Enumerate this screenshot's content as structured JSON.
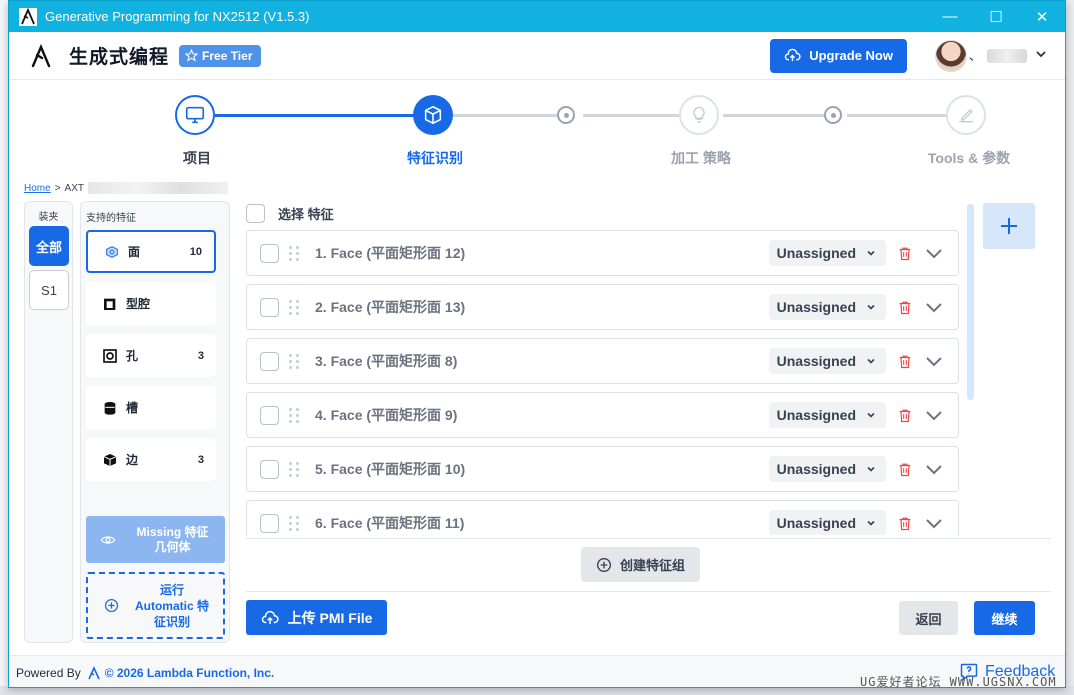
{
  "window": {
    "title": "Generative Programming for NX2512 (V1.5.3)",
    "minimize": "—",
    "maximize": "☐",
    "close": "✕"
  },
  "header": {
    "brand": "生成式编程",
    "tier": "Free Tier",
    "upgrade": "Upgrade Now",
    "user_sep": "、"
  },
  "steps": [
    {
      "label": "项目",
      "state": "done"
    },
    {
      "label": "特征识别",
      "state": "active"
    },
    {
      "label": "加工 策略",
      "state": "pending"
    },
    {
      "label": "Tools & 参数",
      "state": "pending"
    }
  ],
  "breadcrumb": {
    "home": "Home",
    "sep": ">",
    "current": "AXT"
  },
  "leftcol": {
    "title": "装夹",
    "items": [
      "全部",
      "S1"
    ],
    "selected": "全部"
  },
  "features": {
    "title": "支持的特征",
    "items": [
      {
        "label": "面",
        "count": "10",
        "icon": "face-icon",
        "active": true
      },
      {
        "label": "型腔",
        "count": "",
        "icon": "pocket-icon",
        "active": false
      },
      {
        "label": "孔",
        "count": "3",
        "icon": "hole-icon",
        "active": false
      },
      {
        "label": "槽",
        "count": "",
        "icon": "slot-icon",
        "active": false
      },
      {
        "label": "边",
        "count": "3",
        "icon": "edge-icon",
        "active": false
      }
    ],
    "missing": {
      "line1": "Missing 特征",
      "line2": "几何体"
    },
    "auto": {
      "line1": "运行",
      "line2": "Automatic 特",
      "line3": "征识别"
    }
  },
  "main": {
    "select_label": "选择 特征",
    "rows": [
      {
        "name": "1. Face (平面矩形面 12)",
        "status": "Unassigned"
      },
      {
        "name": "2. Face (平面矩形面 13)",
        "status": "Unassigned"
      },
      {
        "name": "3. Face (平面矩形面 8)",
        "status": "Unassigned"
      },
      {
        "name": "4. Face (平面矩形面 9)",
        "status": "Unassigned"
      },
      {
        "name": "5. Face (平面矩形面 10)",
        "status": "Unassigned"
      },
      {
        "name": "6. Face (平面矩形面 11)",
        "status": "Unassigned"
      }
    ],
    "create_group": "创建特征组",
    "upload": "上传 PMI File",
    "back": "返回",
    "next": "继续"
  },
  "footer": {
    "powered": "Powered By",
    "copyright": "© 2026 Lambda Function, Inc.",
    "feedback": "Feedback"
  },
  "watermark": "UG爱好者论坛  WWW.UGSNX.COM",
  "colors": {
    "accent": "#1769e5",
    "titlebar": "#11b2df",
    "danger": "#ef4444"
  }
}
